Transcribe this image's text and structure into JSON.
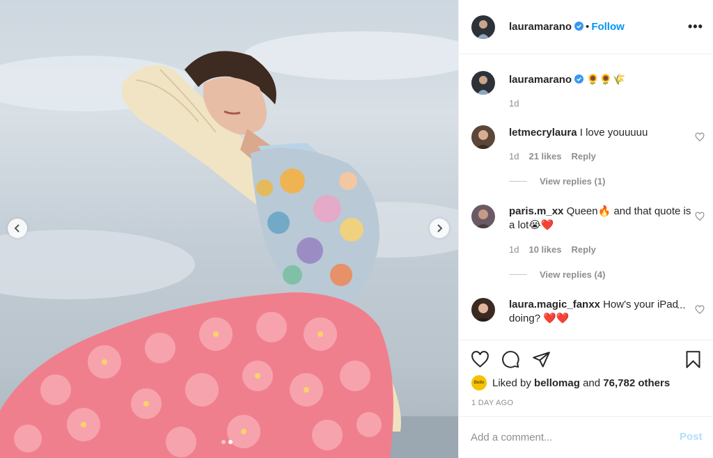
{
  "post": {
    "author": "lauramarano",
    "follow_label": "Follow",
    "separator": "•",
    "more_label": "•••",
    "media": {
      "carousel_total": 2,
      "carousel_active_index": 1
    }
  },
  "caption": {
    "username": "lauramarano",
    "text": "🌻🌻🌾",
    "time": "1d"
  },
  "comments": [
    {
      "username": "letmecrylaura",
      "text": "I love youuuuu",
      "time": "1d",
      "likes": "21 likes",
      "reply_label": "Reply",
      "view_replies": "View replies (1)"
    },
    {
      "username": "paris.m_xx",
      "text": "Queen🔥 and that quote is a lot😭❤️",
      "time": "1d",
      "likes": "10 likes",
      "reply_label": "Reply",
      "view_replies": "View replies (4)"
    },
    {
      "username": "laura.magic_fanxx",
      "text": "How's your iPad doing? ❤️❤️",
      "ellipsis": "..."
    }
  ],
  "likes": {
    "prefix": "Liked by",
    "liker": "bellomag",
    "connector": "and",
    "others": "76,782 others",
    "liker_avatar_text": "Bello"
  },
  "date_label": "1 DAY AGO",
  "composer": {
    "placeholder": "Add a comment...",
    "post_label": "Post"
  },
  "icons": {
    "verified": "verified-badge-icon",
    "heart": "heart-icon",
    "comment": "comment-bubble-icon",
    "share": "paper-plane-icon",
    "save": "bookmark-icon",
    "prev": "chevron-left-icon",
    "next": "chevron-right-icon"
  },
  "colors": {
    "link_blue": "#0095f6",
    "post_disabled": "#b2dffc",
    "verified_blue": "#3897f0",
    "meta_gray": "#8e8e8e"
  }
}
